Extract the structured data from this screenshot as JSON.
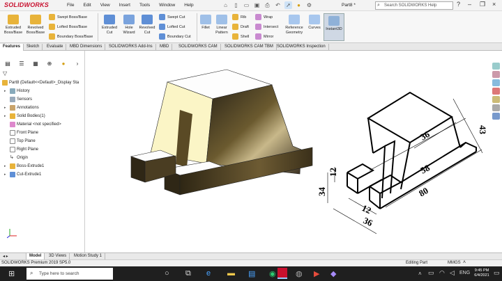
{
  "app": {
    "brand": "SOLIDWORKS",
    "document_title": "Part8 *",
    "search_placeholder": "Search SOLIDWORKS Help"
  },
  "menu": [
    "File",
    "Edit",
    "View",
    "Insert",
    "Tools",
    "Window",
    "Help"
  ],
  "commands": {
    "extruded_boss": "Extruded Boss/Base",
    "revolved_boss": "Revolved Boss/Base",
    "swept_boss": "Swept Boss/Base",
    "lofted_boss": "Lofted Boss/Base",
    "boundary_boss": "Boundary Boss/Base",
    "extruded_cut": "Extruded Cut",
    "hole_wizard": "Hole Wizard",
    "revolved_cut": "Revolved Cut",
    "swept_cut": "Swept Cut",
    "lofted_cut": "Lofted Cut",
    "boundary_cut": "Boundary Cut",
    "fillet": "Fillet",
    "linear_pattern": "Linear Pattern",
    "rib": "Rib",
    "draft": "Draft",
    "shell": "Shell",
    "wrap": "Wrap",
    "intersect": "Intersect",
    "mirror": "Mirror",
    "reference_geometry": "Reference Geometry",
    "curves": "Curves",
    "instant3d": "Instant3D"
  },
  "tabs": [
    "Features",
    "Sketch",
    "Evaluate",
    "MBD Dimensions",
    "SOLIDWORKS Add-Ins",
    "MBD",
    "SOLIDWORKS CAM",
    "SOLIDWORKS CAM TBM",
    "SOLIDWORKS Inspection"
  ],
  "tree": {
    "root": "Part8  (Default<<Default>_Display Sta",
    "items": [
      "History",
      "Sensors",
      "Annotations",
      "Solid Bodies(1)",
      "Material <not specified>",
      "Front Plane",
      "Top Plane",
      "Right Plane",
      "Origin",
      "Boss-Extrude1",
      "Cut-Extrude1"
    ]
  },
  "drawing": {
    "dimensions": [
      "43",
      "36",
      "58",
      "80",
      "12",
      "34",
      "12",
      "36"
    ]
  },
  "bottom_tabs": [
    "Model",
    "3D Views",
    "Motion Study 1"
  ],
  "status": {
    "version": "SOLIDWORKS Premium 2019 SP5.0",
    "mode": "Editing Part",
    "units": "MMGS"
  },
  "taskbar": {
    "search_placeholder": "Type here to search",
    "time": "9:45 PM",
    "date": "6/4/2021"
  },
  "colors": {
    "brand_red": "#c8102e",
    "model_face_top": "#fdfdfd",
    "model_face_front": "#fbf5c6",
    "model_body": "#6b5a2f"
  }
}
